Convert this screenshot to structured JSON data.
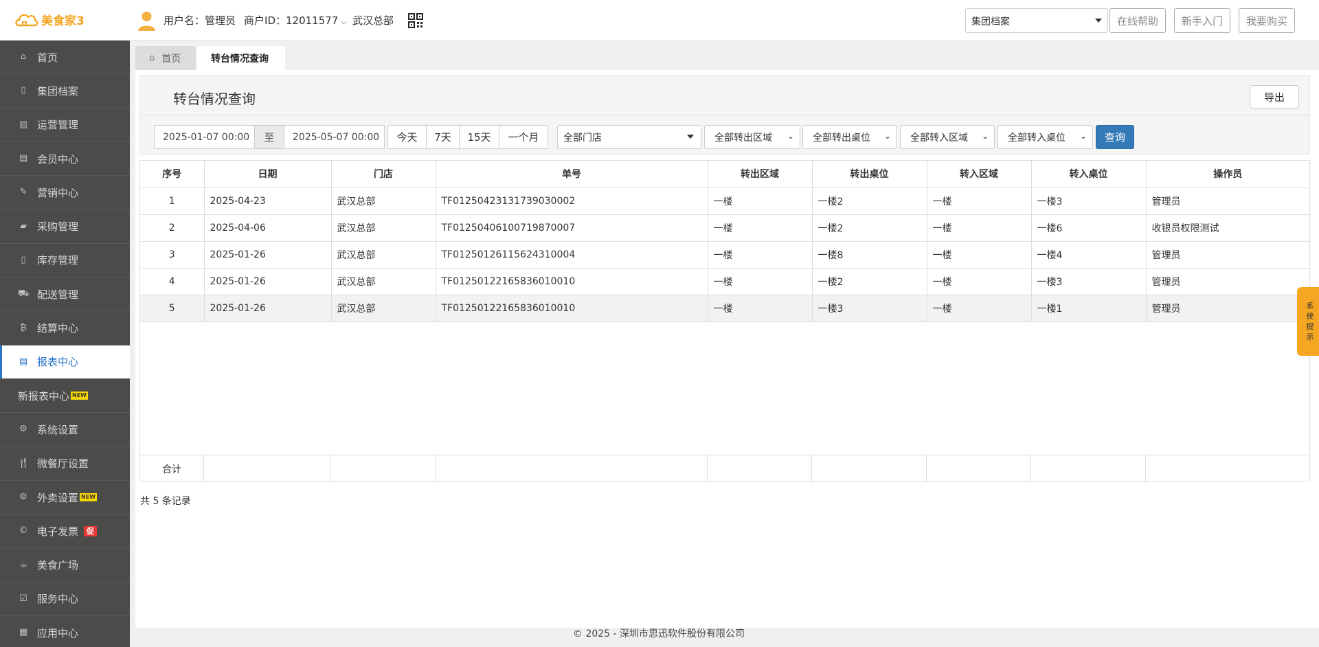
{
  "header": {
    "logo_text": "美食家3",
    "user_label": "用户名：管理员",
    "merchant_label": "商户ID：12011577",
    "store": "武汉总部",
    "archive_select": "集团档案",
    "buttons": [
      "在线帮助",
      "新手入门",
      "我要购买"
    ]
  },
  "sidebar": {
    "items": [
      {
        "label": "首页",
        "icon": "home-icon",
        "glyph": "⌂"
      },
      {
        "label": "集团档案",
        "icon": "document-icon",
        "glyph": "▯"
      },
      {
        "label": "运营管理",
        "icon": "bar-chart-icon",
        "glyph": "▥"
      },
      {
        "label": "会员中心",
        "icon": "id-card-icon",
        "glyph": "▤"
      },
      {
        "label": "营销中心",
        "icon": "edit-icon",
        "glyph": "✎"
      },
      {
        "label": "采购管理",
        "icon": "book-icon",
        "glyph": "▰"
      },
      {
        "label": "库存管理",
        "icon": "file-icon",
        "glyph": "▯"
      },
      {
        "label": "配送管理",
        "icon": "truck-icon",
        "glyph": "⛟"
      },
      {
        "label": "结算中心",
        "icon": "bitcoin-icon",
        "glyph": "₿"
      },
      {
        "label": "报表中心",
        "icon": "report-icon",
        "glyph": "▤"
      },
      {
        "label": "新报表中心",
        "icon": "",
        "glyph": "",
        "badge": "NEW"
      },
      {
        "label": "系统设置",
        "icon": "cogs-icon",
        "glyph": "⚙"
      },
      {
        "label": "微餐厅设置",
        "icon": "cutlery-icon",
        "glyph": "🍴"
      },
      {
        "label": "外卖设置",
        "icon": "gear-icon",
        "glyph": "⚙",
        "badge": "NEW"
      },
      {
        "label": "电子发票",
        "icon": "copyright-icon",
        "glyph": "©",
        "badge_cu": "促"
      },
      {
        "label": "美食广场",
        "icon": "coffee-icon",
        "glyph": "☕"
      },
      {
        "label": "服务中心",
        "icon": "check-square-icon",
        "glyph": "☑"
      },
      {
        "label": "应用中心",
        "icon": "",
        "glyph": "▦"
      }
    ],
    "active_index": 9
  },
  "tabs": [
    "首页",
    "转台情况查询"
  ],
  "page": {
    "title": "转台情况查询",
    "export_label": "导出"
  },
  "filters": {
    "start": "2025-01-07 00:00",
    "to": "至",
    "end": "2025-05-07 00:00",
    "quick": [
      "今天",
      "7天",
      "15天",
      "一个月"
    ],
    "store": "全部门店",
    "out_area": "全部转出区域",
    "out_table": "全部转出桌位",
    "in_area": "全部转入区域",
    "in_table": "全部转入桌位",
    "query_label": "查询"
  },
  "table": {
    "columns": [
      "序号",
      "日期",
      "门店",
      "单号",
      "转出区域",
      "转出桌位",
      "转入区域",
      "转入桌位",
      "操作员"
    ],
    "rows": [
      [
        "1",
        "2025-04-23",
        "武汉总部",
        "TF01250423131739030002",
        "一楼",
        "一楼2",
        "一楼",
        "一楼3",
        "管理员"
      ],
      [
        "2",
        "2025-04-06",
        "武汉总部",
        "TF01250406100719870007",
        "一楼",
        "一楼2",
        "一楼",
        "一楼6",
        "收银员权限测试"
      ],
      [
        "3",
        "2025-01-26",
        "武汉总部",
        "TF01250126115624310004",
        "一楼",
        "一楼8",
        "一楼",
        "一楼4",
        "管理员"
      ],
      [
        "4",
        "2025-01-26",
        "武汉总部",
        "TF01250122165836010010",
        "一楼",
        "一楼2",
        "一楼",
        "一楼3",
        "管理员"
      ],
      [
        "5",
        "2025-01-26",
        "武汉总部",
        "TF01250122165836010010",
        "一楼",
        "一楼3",
        "一楼",
        "一楼1",
        "管理员"
      ]
    ],
    "total_label": "合计"
  },
  "record_count": "共 5 条记录",
  "footer": "© 2025 - 深圳市思迅软件股份有限公司",
  "side_tip": [
    "系",
    "统",
    "提",
    "示"
  ],
  "colors": {
    "accent": "#2a74c8",
    "logo": "#f5a623",
    "sidebar_bg": "#4b4c49",
    "query_btn": "#337ab7"
  }
}
